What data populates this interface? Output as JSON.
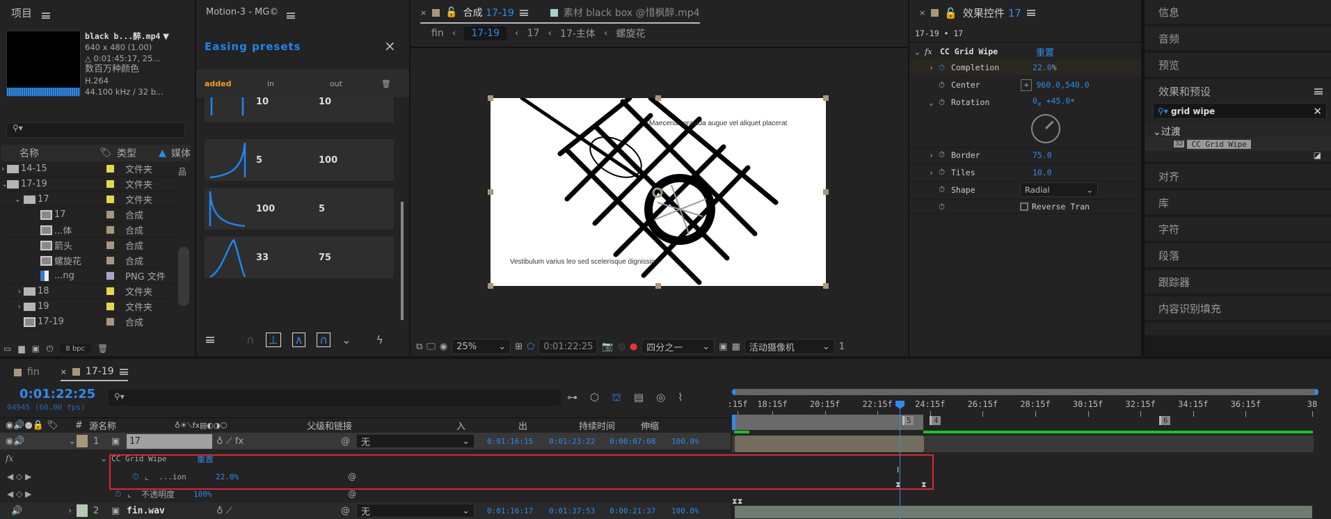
{
  "colors": {
    "accent": "#2d8ceb",
    "label_yellow": "#e3d84a",
    "label_tan": "#a8977a",
    "label_lavender": "#a9a6c8",
    "label_sage": "#b7c8b4",
    "selection_red": "#e0262c",
    "work_area_green": "#1ec01e"
  },
  "project": {
    "title": "项目",
    "file_name": "black b...醉.mp4",
    "dims": "640 x 480 (1.00)",
    "duration": "△ 0:01:45:17, 25...",
    "colors": "数百万种颜色",
    "codec": "H.264",
    "audio": "44.100 kHz / 32 b...",
    "search_placeholder": "",
    "columns": {
      "name": "名称",
      "type": "类型",
      "media": "媒体"
    },
    "items": [
      {
        "name": "14-15",
        "type": "文件夹",
        "icon": "folder-icon",
        "indent": 0,
        "toggle": "›",
        "label": "#e3d84a"
      },
      {
        "name": "17-19",
        "type": "文件夹",
        "icon": "folder-icon",
        "indent": 0,
        "toggle": "⌄",
        "label": "#e3d84a"
      },
      {
        "name": "17",
        "type": "文件夹",
        "icon": "folder-icon",
        "indent": 1,
        "toggle": "⌄",
        "label": "#e3d84a"
      },
      {
        "name": "17",
        "type": "合成",
        "icon": "composition-icon",
        "indent": 2,
        "toggle": "",
        "label": "#a8977a"
      },
      {
        "name": "...体",
        "type": "合成",
        "icon": "composition-icon",
        "indent": 2,
        "toggle": "",
        "label": "#a8977a"
      },
      {
        "name": "箭头",
        "type": "合成",
        "icon": "composition-icon",
        "indent": 2,
        "toggle": "",
        "label": "#a8977a"
      },
      {
        "name": "螺旋花",
        "type": "合成",
        "icon": "composition-icon",
        "indent": 2,
        "toggle": "",
        "label": "#a8977a"
      },
      {
        "name": "...ng",
        "type": "PNG 文件",
        "icon": "image-file-icon",
        "indent": 2,
        "toggle": "",
        "label": "#a9a6c8"
      },
      {
        "name": "18",
        "type": "文件夹",
        "icon": "folder-icon",
        "indent": 1,
        "toggle": "›",
        "label": "#e3d84a"
      },
      {
        "name": "19",
        "type": "文件夹",
        "icon": "folder-icon",
        "indent": 1,
        "toggle": "›",
        "label": "#e3d84a"
      },
      {
        "name": "17-19",
        "type": "合成",
        "icon": "composition-icon",
        "indent": 1,
        "toggle": "",
        "label": "#a8977a"
      }
    ],
    "bpc": "8 bpc"
  },
  "motion": {
    "title": "Motion-3 - MG©",
    "heading": "Easing presets",
    "cols": {
      "added": "added",
      "in": "in",
      "out": "out"
    },
    "presets": [
      {
        "in": "10",
        "out": "10",
        "curve": "linear-spikes"
      },
      {
        "in": "5",
        "out": "100",
        "curve": "ease-in"
      },
      {
        "in": "100",
        "out": "5",
        "curve": "ease-out"
      },
      {
        "in": "33",
        "out": "75",
        "curve": "peak"
      }
    ]
  },
  "comp": {
    "tab_label": "合成",
    "tab_comp": "17-19",
    "footage_tab": "素材 black box @惜枫醉.mp4",
    "breadcrumbs": [
      "fin",
      "17-19",
      "17",
      "17-主体",
      "螺旋花"
    ],
    "canvas_text_top": "Maecenas gravida augue vel aliquet placerat",
    "canvas_text_bottom": "Vestibulum varius leo sed scelerisque dignissim",
    "zoom": "25%",
    "timecode": "0:01:22:25",
    "resolution": "四分之一",
    "camera": "活动摄像机",
    "views": "1"
  },
  "effects": {
    "title": "效果控件",
    "title_layer": "17",
    "breadcrumb": "17-19 • 17",
    "effect_name": "CC Grid Wipe",
    "reset": "重置",
    "props": {
      "completion_label": "Completion",
      "completion": "22.0",
      "completion_unit": "%",
      "center_label": "Center",
      "center": "960.0,540.0",
      "rotation_label": "Rotation",
      "rotation_turns": "0",
      "rotation_x": "x",
      "rotation_deg": "+45.0",
      "rotation_unit": "°",
      "border_label": "Border",
      "border": "75.0",
      "tiles_label": "Tiles",
      "tiles": "10.0",
      "shape_label": "Shape",
      "shape": "Radial",
      "reverse_label": "Reverse Tran"
    },
    "rotation_degrees": 45,
    "reverse_checked": false
  },
  "right": {
    "tabs_top": [
      "信息",
      "音频",
      "预览"
    ],
    "effects_presets": "效果和预设",
    "search": "grid wipe",
    "category": "过渡",
    "result": "CC Grid Wipe",
    "result_badge": "32",
    "tabs_bottom": [
      "对齐",
      "库",
      "字符",
      "段落",
      "跟踪器",
      "内容识别填充"
    ]
  },
  "timeline": {
    "tabs": [
      {
        "label": "fin"
      },
      {
        "label": "17-19"
      }
    ],
    "timecode": "0:01:22:25",
    "frame_info": "04945 (60.00 fps)",
    "headers": {
      "num": "#",
      "source": "源名称",
      "parent": "父级和链接",
      "in": "入",
      "out": "出",
      "duration": "持续时间",
      "stretch": "伸缩"
    },
    "layers": [
      {
        "num": "1",
        "name": "17",
        "parent": "无",
        "in": "0:01:16:15",
        "out": "0:01:23:22",
        "duration": "0:00:07:08",
        "stretch": "100.0%",
        "label": "#a8977a"
      },
      {
        "num": "2",
        "name": "fin.wav",
        "parent": "无",
        "in": "0:01:16:17",
        "out": "0:01:37:53",
        "duration": "0:00:21:37",
        "stretch": "100.0%",
        "label": "#b7c8b4"
      }
    ],
    "effect_row": {
      "fx": "fx",
      "name": "CC Grid Wipe",
      "reset": "重置"
    },
    "completion_row": {
      "name": "...ion",
      "value": "22.0",
      "unit": "%"
    },
    "opacity_row": {
      "name": "不透明度",
      "value": "100%"
    },
    "ruler": [
      ":15f",
      "18:15f",
      "20:15f",
      "22:15f",
      "24:15f",
      "26:15f",
      "28:15f",
      "30:15f",
      "32:15f",
      "34:15f",
      "36:15f",
      "38"
    ],
    "markers": [
      "5",
      "4",
      "6"
    ]
  }
}
